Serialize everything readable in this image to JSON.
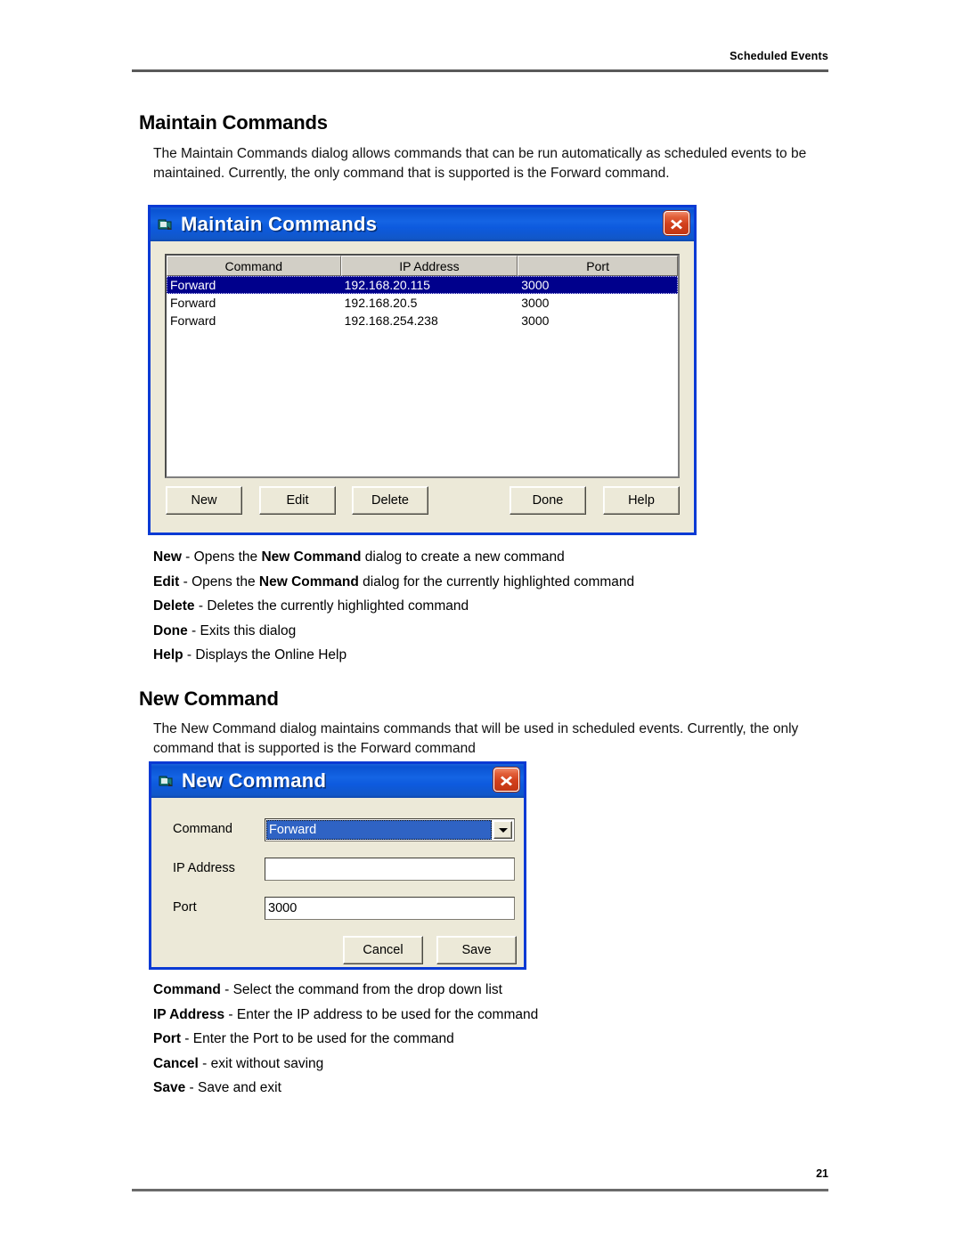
{
  "page": {
    "running_head": "Scheduled Events",
    "page_number": "21"
  },
  "sections": [
    {
      "heading": "Maintain Commands",
      "paragraph": "The Maintain Commands dialog allows commands that can be run automatically as scheduled events to be maintained.  Currently, the only command that is supported is the Forward command."
    },
    {
      "heading": "New Command",
      "paragraph": "The New Command dialog maintains commands that will be used in scheduled events. Currently, the only command that is supported is the Forward command"
    }
  ],
  "maintain_dialog": {
    "title": "Maintain Commands",
    "icon": "window-document-icon",
    "close_label": "✕",
    "table": {
      "columns": [
        "Command",
        "IP Address",
        "Port"
      ],
      "rows": [
        {
          "command": "Forward",
          "ip": "192.168.20.115",
          "port": "3000",
          "selected": true
        },
        {
          "command": "Forward",
          "ip": "192.168.20.5",
          "port": "3000",
          "selected": false
        },
        {
          "command": "Forward",
          "ip": "192.168.254.238",
          "port": "3000",
          "selected": false
        }
      ]
    },
    "buttons": {
      "new": "New",
      "edit": "Edit",
      "delete": "Delete",
      "done": "Done",
      "help": "Help"
    }
  },
  "maintain_descriptions": [
    {
      "term": "New",
      "sep": " - ",
      "text_before": "Opens the ",
      "emphasis": "New Command",
      "text_after": " dialog to create a new command"
    },
    {
      "term": "Edit",
      "sep": " - ",
      "text_before": "Opens the ",
      "emphasis": "New Command",
      "text_after": " dialog for the currently highlighted command"
    },
    {
      "term": "Delete",
      "sep": " - ",
      "text_before": "Deletes the currently highlighted command",
      "emphasis": "",
      "text_after": ""
    },
    {
      "term": "Done",
      "sep": " - ",
      "text_before": "Exits this dialog",
      "emphasis": "",
      "text_after": ""
    },
    {
      "term": "Help",
      "sep": " - ",
      "text_before": "Displays the Online Help",
      "emphasis": "",
      "text_after": ""
    }
  ],
  "new_command_dialog": {
    "title": "New Command",
    "icon": "window-document-icon",
    "close_label": "✕",
    "fields": {
      "command_label": "Command",
      "command_value": "Forward",
      "ip_label": "IP Address",
      "ip_value": "",
      "port_label": "Port",
      "port_value": "3000"
    },
    "buttons": {
      "cancel": "Cancel",
      "save": "Save"
    }
  },
  "new_command_descriptions": [
    {
      "term": "Command",
      "sep": " - ",
      "text_before": "Select the command from the drop down list",
      "emphasis": "",
      "text_after": ""
    },
    {
      "term": "IP Address",
      "sep": " - ",
      "text_before": "Enter the IP address to be used for the command",
      "emphasis": "",
      "text_after": ""
    },
    {
      "term": "Port",
      "sep": " - ",
      "text_before": "Enter the Port to be used for the command",
      "emphasis": "",
      "text_after": ""
    },
    {
      "term": "Cancel",
      "sep": " - ",
      "text_before": "exit without saving",
      "emphasis": "",
      "text_after": ""
    },
    {
      "term": "Save",
      "sep": " - ",
      "text_before": "Save and exit",
      "emphasis": "",
      "text_after": ""
    }
  ],
  "colors": {
    "titlebar_blue": "#0d5ade",
    "window_border": "#0a3ad4",
    "dialog_face": "#ece9d8",
    "selection_navy": "#00008c",
    "combo_selection": "#2f63c4",
    "close_red": "#d2401c"
  }
}
